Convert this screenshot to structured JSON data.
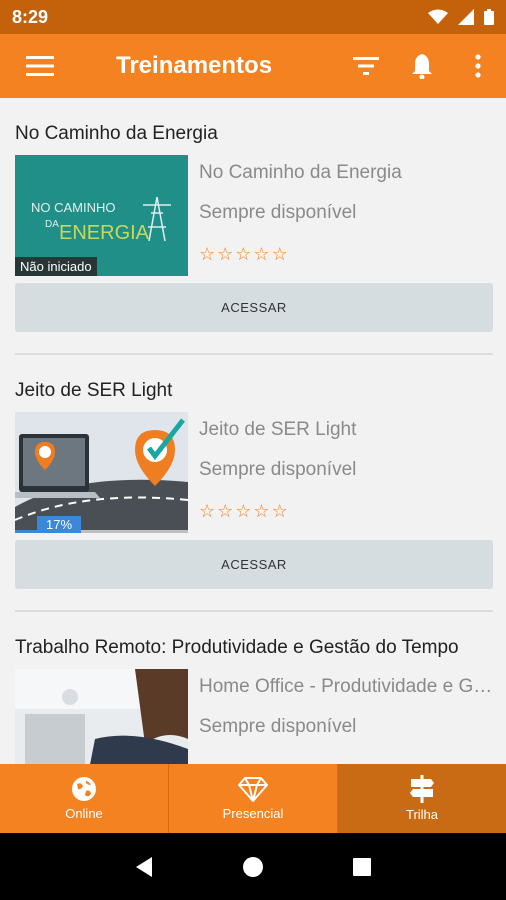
{
  "status_bar": {
    "time": "8:29"
  },
  "app_bar": {
    "title": "Treinamentos"
  },
  "courses": [
    {
      "title": "No Caminho da Energia",
      "name": "No Caminho da Energia",
      "availability": "Sempre disponível",
      "status": "Não iniciado",
      "rating": 0,
      "button": "ACESSAR",
      "thumb": {
        "line1": "NO CAMINHO",
        "line2": "DA",
        "line3": "ENERGIA"
      }
    },
    {
      "title": "Jeito de SER Light",
      "name": "Jeito de SER Light",
      "availability": "Sempre disponível",
      "progress": "17%",
      "progress_value": 0.17,
      "rating": 0,
      "button": "ACESSAR"
    },
    {
      "title": "Trabalho Remoto: Produtividade e Gestão do Tempo",
      "name": "Home Office - Produtividade e Gestão do Tempo",
      "availability": "Sempre disponível"
    }
  ],
  "bottom_nav": [
    {
      "label": "Online",
      "icon": "globe-icon"
    },
    {
      "label": "Presencial",
      "icon": "diamond-icon"
    },
    {
      "label": "Trilha",
      "icon": "signpost-icon",
      "active": true
    }
  ],
  "colors": {
    "primary": "#f48220",
    "status_bar": "#c4620c",
    "active_tab": "#c96a14",
    "progress": "#3b87d8"
  }
}
